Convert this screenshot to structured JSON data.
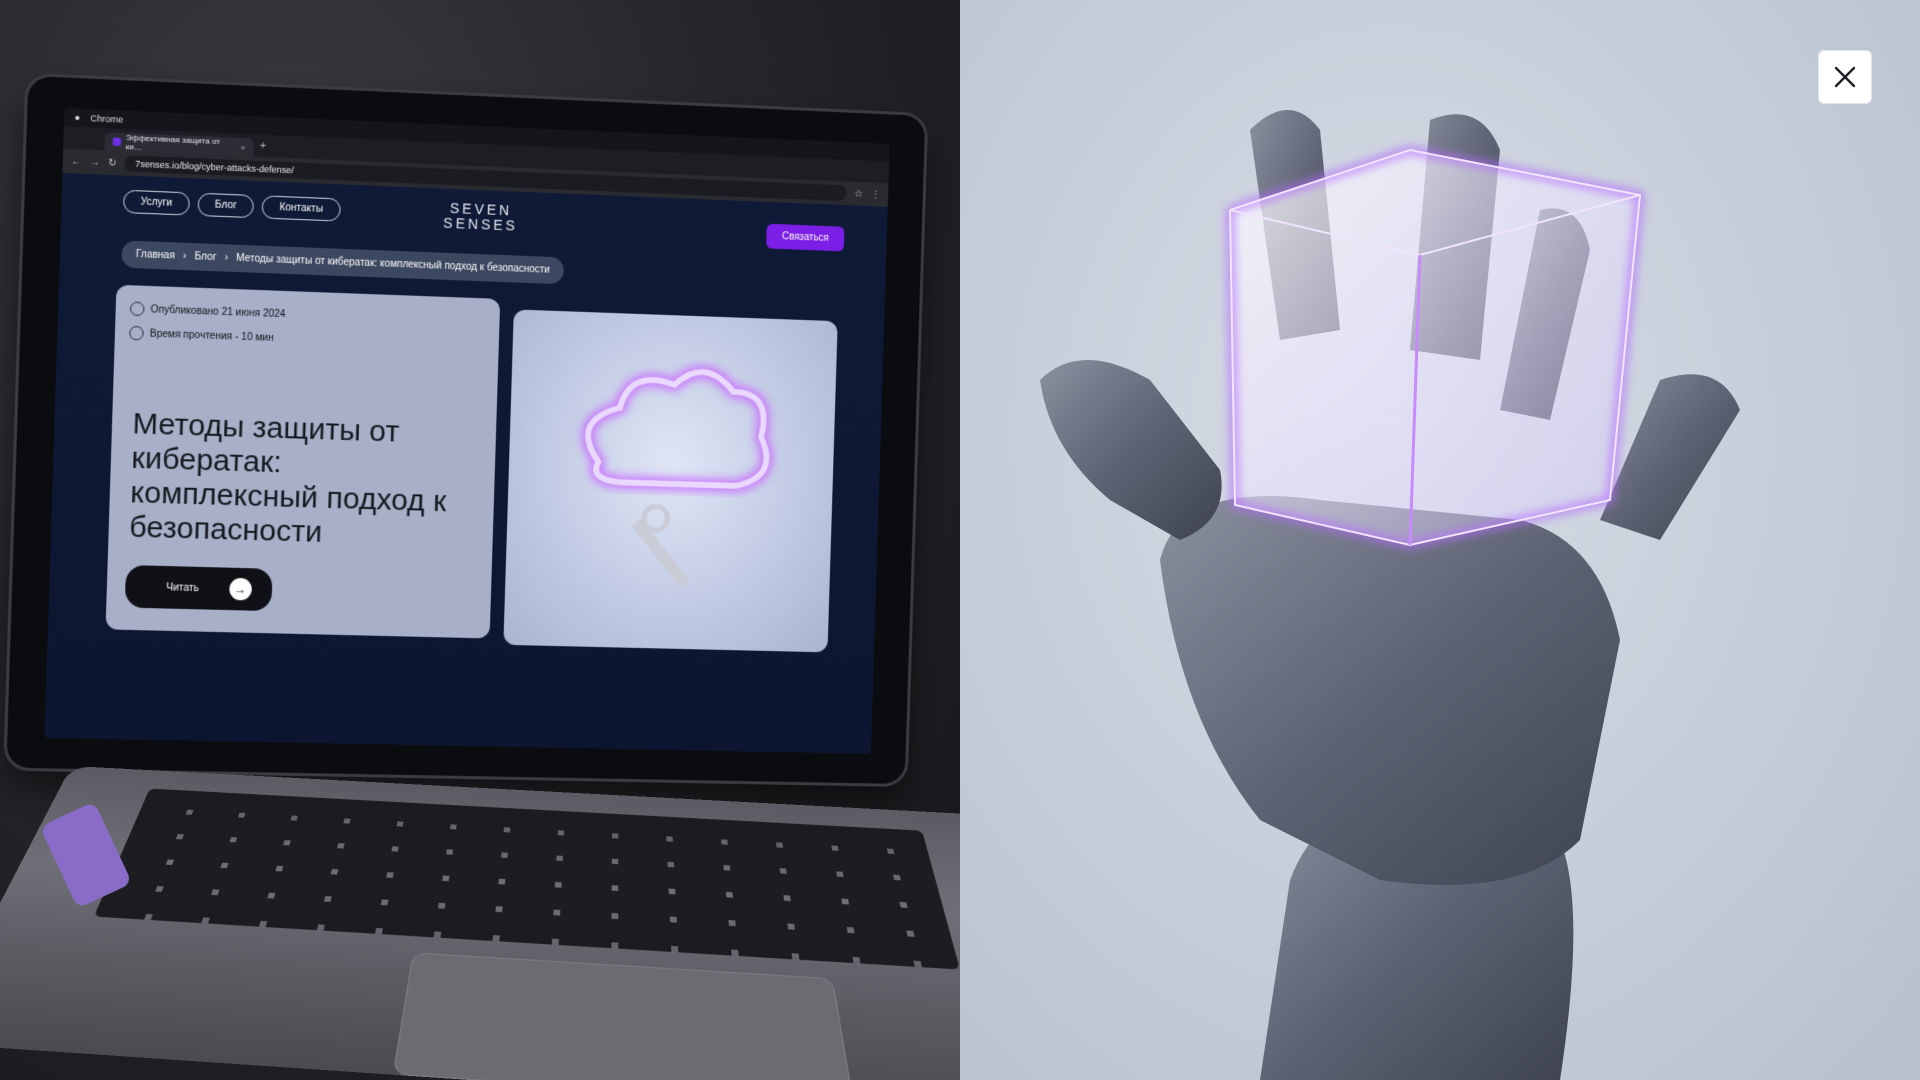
{
  "browser": {
    "app_name": "Chrome",
    "tab_title": "Эффективная защита от ки…",
    "url": "7senses.io/blog/cyber-attacks-defense/"
  },
  "site": {
    "nav": [
      "Услуги",
      "Блог",
      "Контакты"
    ],
    "logo_top": "SEVEN",
    "logo_bottom": "SENSES",
    "cta_label": "Связаться",
    "breadcrumb": [
      "Главная",
      "Блог",
      "Методы защиты от кибератак: комплексный подход к безопасности"
    ],
    "published": "Опубликовано 21 июня 2024",
    "read_time": "Время прочтения - 10 мин",
    "title": "Методы защиты от кибератак: комплексный подход к безопасности",
    "read_button": "Читать",
    "accent_color": "#7b1ee6"
  },
  "overlay": {
    "close_icon": "close-icon"
  }
}
